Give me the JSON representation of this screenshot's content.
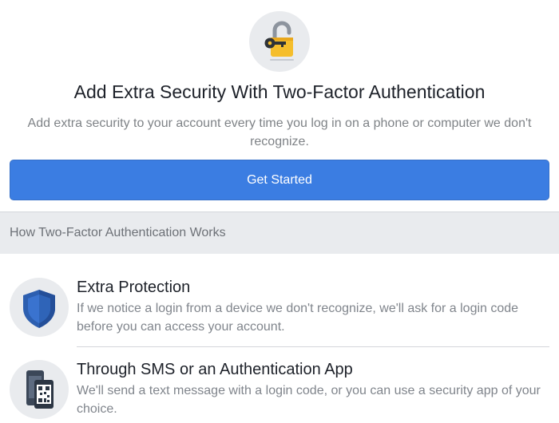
{
  "header": {
    "icon": "padlock-key-icon",
    "title": "Add Extra Security With Two-Factor Authentication",
    "subtitle": "Add extra security to your account every time you log in on a phone or computer we don't recognize."
  },
  "cta": {
    "label": "Get Started"
  },
  "section": {
    "heading": "How Two-Factor Authentication Works"
  },
  "features": [
    {
      "icon": "shield-icon",
      "title": "Extra Protection",
      "description": "If we notice a login from a device we don't recognize, we'll ask for a login code before you can access your account."
    },
    {
      "icon": "phone-qr-icon",
      "title": "Through SMS or an Authentication App",
      "description": "We'll send a text message with a login code, or you can use a security app of your choice."
    }
  ],
  "colors": {
    "accent": "#3b7de2",
    "background_band": "#e9ebee",
    "lock_yellow": "#f5be2c",
    "shield_blue": "#2d5fb0"
  }
}
